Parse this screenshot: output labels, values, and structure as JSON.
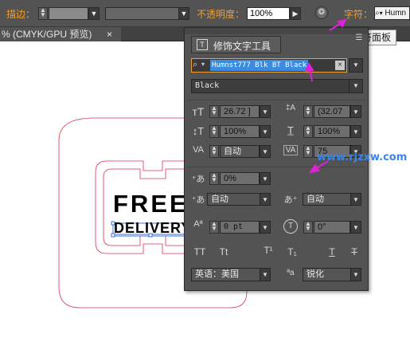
{
  "toolbar": {
    "stroke_label": "描边：",
    "opacity_label": "不透明度：",
    "opacity_value": "100%",
    "char_label": "字符：",
    "font_field_text": "Humn"
  },
  "tooltip": {
    "text": "字符面板"
  },
  "tabs": [
    {
      "label": "% (CMYK/GPU 预览)",
      "close": "×"
    }
  ],
  "canvas": {
    "headline": "FREE",
    "subline": "DELIVERY"
  },
  "panel": {
    "touch_type_label": "修饰文字工具",
    "font_family": "Humnst777 Blk BT Black",
    "font_style": "Black",
    "font_size": "26.72 ]",
    "leading": "(32.07",
    "vertical_scale": "100%",
    "horizontal_scale": "100%",
    "kerning": "自动",
    "tracking": "75",
    "tsume": "0%",
    "aki_left": "自动",
    "aki_right": "自动",
    "baseline_shift": "0 pt",
    "rotation": "0°",
    "style_buttons": [
      "TT",
      "Tt",
      "T¹",
      "T₁",
      "T",
      "T"
    ],
    "language": "英语：美国",
    "antialias_icon_text": "ªa",
    "antialias": "锐化"
  },
  "watermark": {
    "text": "www.rjzxw.com"
  },
  "colors": {
    "ui_bg": "#535353",
    "orange": "#f0a030",
    "highlight": "#3b8ce0",
    "watermark": "#3a86e8",
    "annotation_arrow": "#e020d8",
    "artboard_stroke": "#e03050"
  }
}
